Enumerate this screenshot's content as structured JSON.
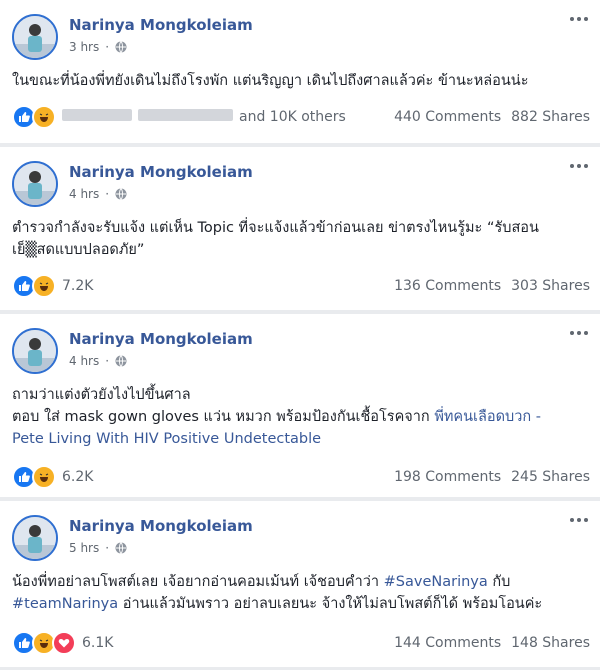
{
  "posts": [
    {
      "author": "Narinya Mongkoleiam",
      "time": "3 hrs",
      "text_lines": [
        "ในขณะที่น้องพี่ทยังเดินไม่ถึงโรงพัก แต่นริญญา เดินไปถึงศาลแล้วค่ะ ข้านะหล่อนน่ะ"
      ],
      "reaction_count": "and 10K others",
      "comments": "440 Comments",
      "shares": "882 Shares"
    },
    {
      "author": "Narinya Mongkoleiam",
      "time": "4 hrs",
      "text_lines": [
        "ตำรวจกำลังจะรับแจ้ง แต่เห็น Topic ที่จะแจ้งแล้วข้าก่อนเลย ข่าตรงไหนรู้มะ “รับสอน",
        "เย็▒สดแบบปลอดภัย”"
      ],
      "reaction_count": "7.2K",
      "comments": "136 Comments",
      "shares": "303 Shares"
    },
    {
      "author": "Narinya Mongkoleiam",
      "time": "4 hrs",
      "text_line1": "ถามว่าแต่งตัวยังไงไปขึ้นศาล",
      "text_line2_plain": "ตอบ ใส่ mask gown gloves แว่น หมวก พร้อมป้องกันเชื้อโรคจาก ",
      "text_line2_link": "พี่ทคนเลือดบวก -",
      "text_line3_link": "Pete Living With HIV Positive Undetectable",
      "reaction_count": "6.2K",
      "comments": "198 Comments",
      "shares": "245 Shares"
    },
    {
      "author": "Narinya Mongkoleiam",
      "time": "5 hrs",
      "text_line1_plain": "น้องพี่ทอย่าลบโพสต์เลย เจ้อยากอ่านคอมเม้นท์ เจ้ชอบคำว่า ",
      "text_line1_link": "#SaveNarinya",
      "text_line1_end": " กับ",
      "text_line2_link": "#teamNarinya",
      "text_line2_plain": " อ่านแล้วมันพราว อย่าลบเลยนะ จ้างให้ไม่ลบโพสต์ก็ได้ พร้อมโอนค่ะ",
      "reaction_count": "6.1K",
      "comments": "144 Comments",
      "shares": "148 Shares"
    }
  ],
  "icons": {
    "privacy": "globe-icon",
    "menu": "more-options-icon",
    "reactions": [
      "like-icon",
      "haha-icon",
      "love-icon"
    ]
  },
  "colors": {
    "name": "#385898",
    "link": "#385898",
    "like": "#1877f2",
    "haha": "#f7b125",
    "love": "#f33e58",
    "background": "#e9ebee"
  }
}
